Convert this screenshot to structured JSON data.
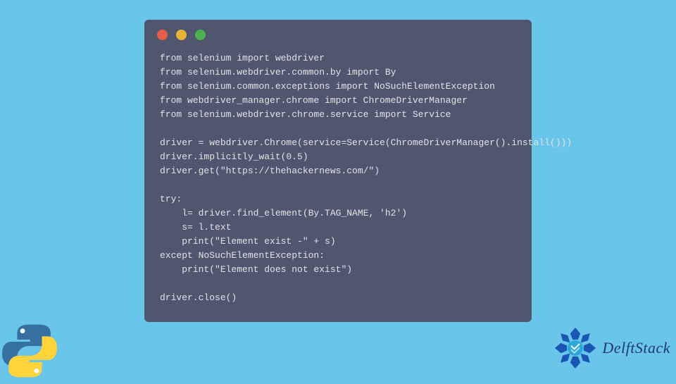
{
  "code": {
    "lines": [
      "from selenium import webdriver",
      "from selenium.webdriver.common.by import By",
      "from selenium.common.exceptions import NoSuchElementException",
      "from webdriver_manager.chrome import ChromeDriverManager",
      "from selenium.webdriver.chrome.service import Service",
      "",
      "driver = webdriver.Chrome(service=Service(ChromeDriverManager().install()))",
      "driver.implicitly_wait(0.5)",
      "driver.get(\"https://thehackernews.com/\")",
      "",
      "try:",
      "    l= driver.find_element(By.TAG_NAME, 'h2')",
      "    s= l.text",
      "    print(\"Element exist -\" + s)",
      "except NoSuchElementException:",
      "    print(\"Element does not exist\")",
      "",
      "driver.close()"
    ]
  },
  "brand": {
    "name": "DelftStack"
  }
}
